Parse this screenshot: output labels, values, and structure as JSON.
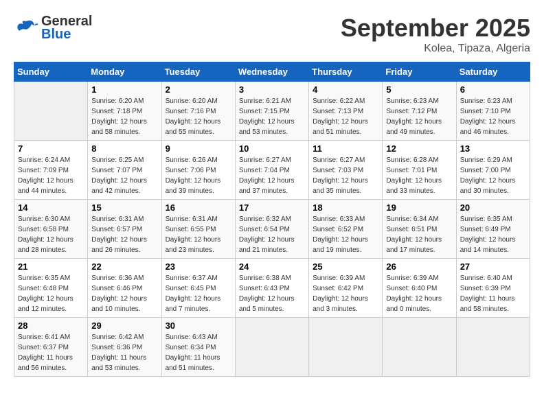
{
  "header": {
    "logo_general": "General",
    "logo_blue": "Blue",
    "month": "September 2025",
    "location": "Kolea, Tipaza, Algeria"
  },
  "days_of_week": [
    "Sunday",
    "Monday",
    "Tuesday",
    "Wednesday",
    "Thursday",
    "Friday",
    "Saturday"
  ],
  "weeks": [
    [
      {
        "day": "",
        "sunrise": "",
        "sunset": "",
        "daylight": "",
        "empty": true
      },
      {
        "day": "1",
        "sunrise": "Sunrise: 6:20 AM",
        "sunset": "Sunset: 7:18 PM",
        "daylight": "Daylight: 12 hours and 58 minutes.",
        "empty": false
      },
      {
        "day": "2",
        "sunrise": "Sunrise: 6:20 AM",
        "sunset": "Sunset: 7:16 PM",
        "daylight": "Daylight: 12 hours and 55 minutes.",
        "empty": false
      },
      {
        "day": "3",
        "sunrise": "Sunrise: 6:21 AM",
        "sunset": "Sunset: 7:15 PM",
        "daylight": "Daylight: 12 hours and 53 minutes.",
        "empty": false
      },
      {
        "day": "4",
        "sunrise": "Sunrise: 6:22 AM",
        "sunset": "Sunset: 7:13 PM",
        "daylight": "Daylight: 12 hours and 51 minutes.",
        "empty": false
      },
      {
        "day": "5",
        "sunrise": "Sunrise: 6:23 AM",
        "sunset": "Sunset: 7:12 PM",
        "daylight": "Daylight: 12 hours and 49 minutes.",
        "empty": false
      },
      {
        "day": "6",
        "sunrise": "Sunrise: 6:23 AM",
        "sunset": "Sunset: 7:10 PM",
        "daylight": "Daylight: 12 hours and 46 minutes.",
        "empty": false
      }
    ],
    [
      {
        "day": "7",
        "sunrise": "Sunrise: 6:24 AM",
        "sunset": "Sunset: 7:09 PM",
        "daylight": "Daylight: 12 hours and 44 minutes.",
        "empty": false
      },
      {
        "day": "8",
        "sunrise": "Sunrise: 6:25 AM",
        "sunset": "Sunset: 7:07 PM",
        "daylight": "Daylight: 12 hours and 42 minutes.",
        "empty": false
      },
      {
        "day": "9",
        "sunrise": "Sunrise: 6:26 AM",
        "sunset": "Sunset: 7:06 PM",
        "daylight": "Daylight: 12 hours and 39 minutes.",
        "empty": false
      },
      {
        "day": "10",
        "sunrise": "Sunrise: 6:27 AM",
        "sunset": "Sunset: 7:04 PM",
        "daylight": "Daylight: 12 hours and 37 minutes.",
        "empty": false
      },
      {
        "day": "11",
        "sunrise": "Sunrise: 6:27 AM",
        "sunset": "Sunset: 7:03 PM",
        "daylight": "Daylight: 12 hours and 35 minutes.",
        "empty": false
      },
      {
        "day": "12",
        "sunrise": "Sunrise: 6:28 AM",
        "sunset": "Sunset: 7:01 PM",
        "daylight": "Daylight: 12 hours and 33 minutes.",
        "empty": false
      },
      {
        "day": "13",
        "sunrise": "Sunrise: 6:29 AM",
        "sunset": "Sunset: 7:00 PM",
        "daylight": "Daylight: 12 hours and 30 minutes.",
        "empty": false
      }
    ],
    [
      {
        "day": "14",
        "sunrise": "Sunrise: 6:30 AM",
        "sunset": "Sunset: 6:58 PM",
        "daylight": "Daylight: 12 hours and 28 minutes.",
        "empty": false
      },
      {
        "day": "15",
        "sunrise": "Sunrise: 6:31 AM",
        "sunset": "Sunset: 6:57 PM",
        "daylight": "Daylight: 12 hours and 26 minutes.",
        "empty": false
      },
      {
        "day": "16",
        "sunrise": "Sunrise: 6:31 AM",
        "sunset": "Sunset: 6:55 PM",
        "daylight": "Daylight: 12 hours and 23 minutes.",
        "empty": false
      },
      {
        "day": "17",
        "sunrise": "Sunrise: 6:32 AM",
        "sunset": "Sunset: 6:54 PM",
        "daylight": "Daylight: 12 hours and 21 minutes.",
        "empty": false
      },
      {
        "day": "18",
        "sunrise": "Sunrise: 6:33 AM",
        "sunset": "Sunset: 6:52 PM",
        "daylight": "Daylight: 12 hours and 19 minutes.",
        "empty": false
      },
      {
        "day": "19",
        "sunrise": "Sunrise: 6:34 AM",
        "sunset": "Sunset: 6:51 PM",
        "daylight": "Daylight: 12 hours and 17 minutes.",
        "empty": false
      },
      {
        "day": "20",
        "sunrise": "Sunrise: 6:35 AM",
        "sunset": "Sunset: 6:49 PM",
        "daylight": "Daylight: 12 hours and 14 minutes.",
        "empty": false
      }
    ],
    [
      {
        "day": "21",
        "sunrise": "Sunrise: 6:35 AM",
        "sunset": "Sunset: 6:48 PM",
        "daylight": "Daylight: 12 hours and 12 minutes.",
        "empty": false
      },
      {
        "day": "22",
        "sunrise": "Sunrise: 6:36 AM",
        "sunset": "Sunset: 6:46 PM",
        "daylight": "Daylight: 12 hours and 10 minutes.",
        "empty": false
      },
      {
        "day": "23",
        "sunrise": "Sunrise: 6:37 AM",
        "sunset": "Sunset: 6:45 PM",
        "daylight": "Daylight: 12 hours and 7 minutes.",
        "empty": false
      },
      {
        "day": "24",
        "sunrise": "Sunrise: 6:38 AM",
        "sunset": "Sunset: 6:43 PM",
        "daylight": "Daylight: 12 hours and 5 minutes.",
        "empty": false
      },
      {
        "day": "25",
        "sunrise": "Sunrise: 6:39 AM",
        "sunset": "Sunset: 6:42 PM",
        "daylight": "Daylight: 12 hours and 3 minutes.",
        "empty": false
      },
      {
        "day": "26",
        "sunrise": "Sunrise: 6:39 AM",
        "sunset": "Sunset: 6:40 PM",
        "daylight": "Daylight: 12 hours and 0 minutes.",
        "empty": false
      },
      {
        "day": "27",
        "sunrise": "Sunrise: 6:40 AM",
        "sunset": "Sunset: 6:39 PM",
        "daylight": "Daylight: 11 hours and 58 minutes.",
        "empty": false
      }
    ],
    [
      {
        "day": "28",
        "sunrise": "Sunrise: 6:41 AM",
        "sunset": "Sunset: 6:37 PM",
        "daylight": "Daylight: 11 hours and 56 minutes.",
        "empty": false
      },
      {
        "day": "29",
        "sunrise": "Sunrise: 6:42 AM",
        "sunset": "Sunset: 6:36 PM",
        "daylight": "Daylight: 11 hours and 53 minutes.",
        "empty": false
      },
      {
        "day": "30",
        "sunrise": "Sunrise: 6:43 AM",
        "sunset": "Sunset: 6:34 PM",
        "daylight": "Daylight: 11 hours and 51 minutes.",
        "empty": false
      },
      {
        "day": "",
        "sunrise": "",
        "sunset": "",
        "daylight": "",
        "empty": true
      },
      {
        "day": "",
        "sunrise": "",
        "sunset": "",
        "daylight": "",
        "empty": true
      },
      {
        "day": "",
        "sunrise": "",
        "sunset": "",
        "daylight": "",
        "empty": true
      },
      {
        "day": "",
        "sunrise": "",
        "sunset": "",
        "daylight": "",
        "empty": true
      }
    ]
  ]
}
